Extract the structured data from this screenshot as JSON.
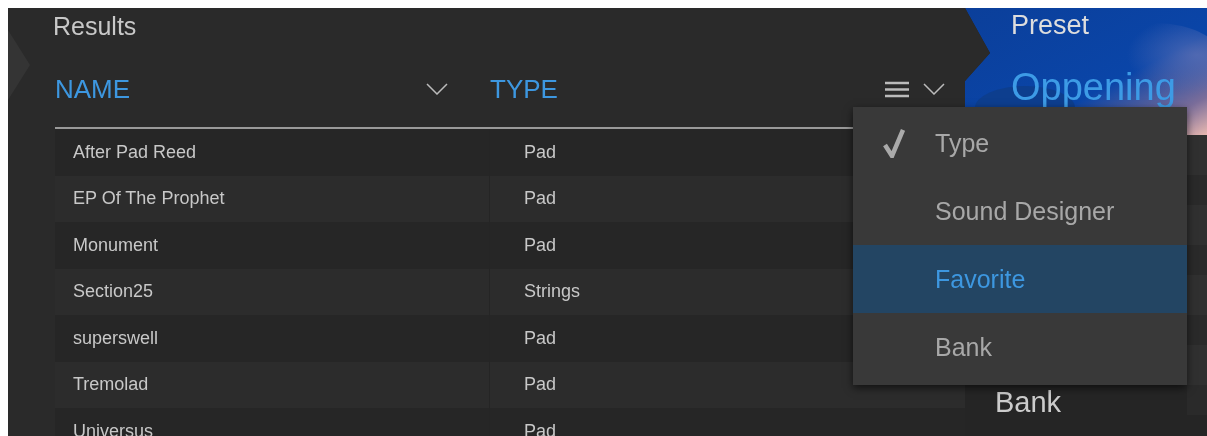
{
  "results": {
    "title": "Results",
    "columns": [
      {
        "label": "NAME"
      },
      {
        "label": "TYPE"
      }
    ],
    "rows": [
      {
        "name": "After Pad Reed",
        "type": "Pad"
      },
      {
        "name": "EP Of The Prophet",
        "type": "Pad"
      },
      {
        "name": "Monument",
        "type": "Pad"
      },
      {
        "name": "Section25",
        "type": "Strings"
      },
      {
        "name": "superswell",
        "type": "Pad"
      },
      {
        "name": "Tremolad",
        "type": "Pad"
      },
      {
        "name": "Universus",
        "type": "Pad"
      }
    ]
  },
  "column_menu": {
    "items": [
      {
        "label": "Type",
        "checked": true,
        "selected": false
      },
      {
        "label": "Sound Designer",
        "checked": false,
        "selected": false
      },
      {
        "label": "Favorite",
        "checked": false,
        "selected": true
      },
      {
        "label": "Bank",
        "checked": false,
        "selected": false
      }
    ]
  },
  "preset": {
    "title": "Preset",
    "name": "Oppening",
    "field_label": "Bank"
  }
}
